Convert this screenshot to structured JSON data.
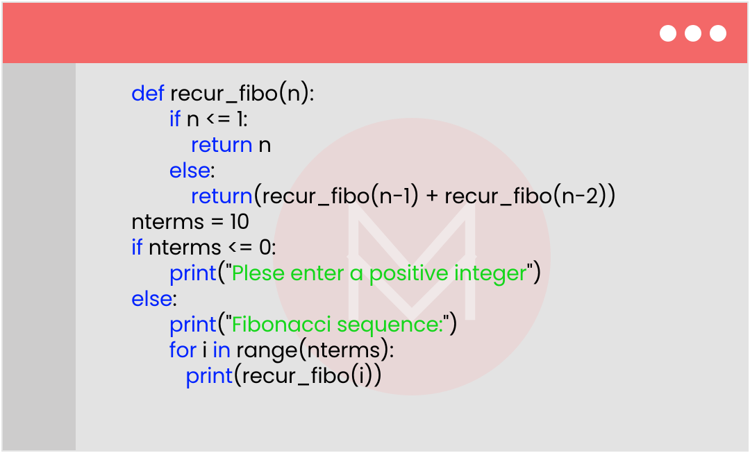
{
  "code": {
    "line1": {
      "kw": "def",
      "rest": " recur_fibo(n):"
    },
    "line2": {
      "pre": "       ",
      "kw": "if",
      "rest": " n <= 1:"
    },
    "line3": {
      "pre": "           ",
      "kw": "return",
      "rest": " n"
    },
    "line4": {
      "pre": "       ",
      "kw": "else",
      "rest": ":"
    },
    "line5": {
      "pre": "           ",
      "kw": "return",
      "rest": "(recur_fibo(n-1) + recur_fibo(n-2))"
    },
    "line6": {
      "rest": "nterms = 10"
    },
    "line7": {
      "kw": "if",
      "rest": " nterms <= 0:"
    },
    "line8": {
      "pre": "       ",
      "fn": "print",
      "open": "(\"",
      "str": "Plese enter a positive integer",
      "close": "\")"
    },
    "line9": {
      "kw": "else",
      "rest": ":"
    },
    "line10": {
      "pre": "       ",
      "fn": "print",
      "open": "(\"",
      "str": "Fibonacci sequence:",
      "close": "\")"
    },
    "line11": {
      "pre": "       ",
      "kw": "for",
      "mid": " i ",
      "kw2": "in",
      "rest": " range(nterms):"
    },
    "line12": {
      "pre": "          ",
      "fn": "print",
      "rest": "(recur_fibo(i))"
    }
  },
  "colors": {
    "titlebar": "#f36868",
    "background": "#e3e3e3",
    "gutter": "#cdcccc",
    "keyword": "#0023ff",
    "string": "#15d61b"
  }
}
